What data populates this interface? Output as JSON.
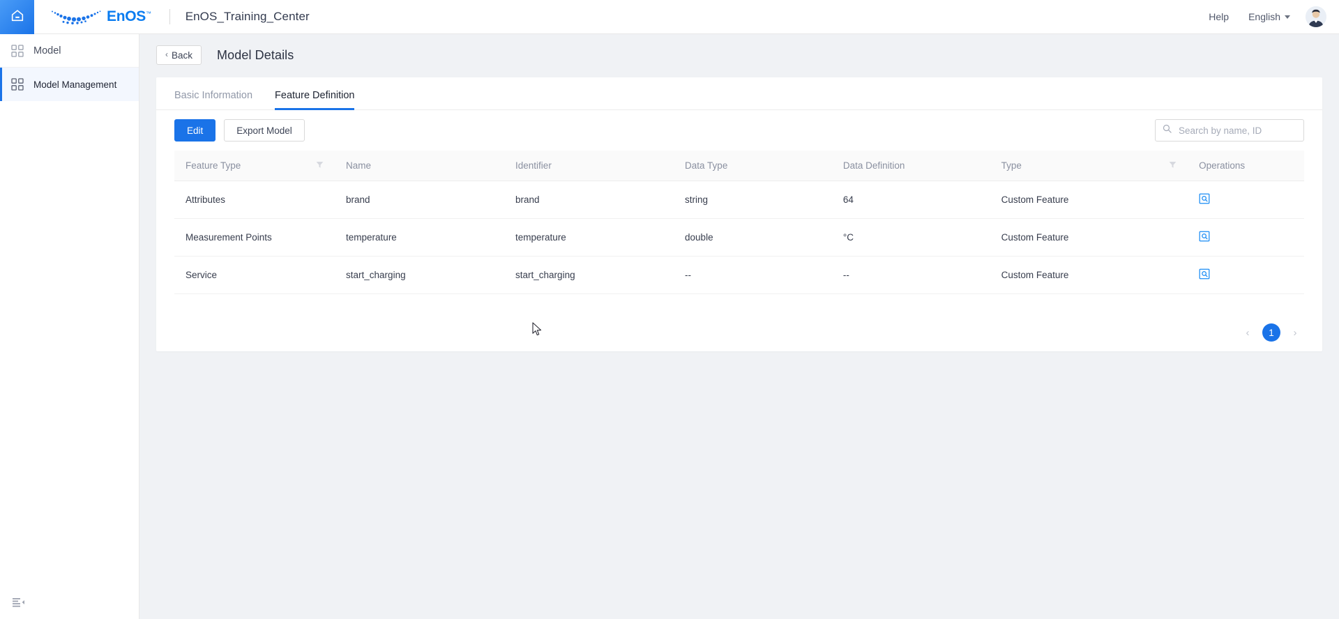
{
  "header": {
    "home_icon": "home-icon",
    "logo_text": "EnOS",
    "logo_tm": "™",
    "project_title": "EnOS_Training_Center",
    "help_label": "Help",
    "language_label": "English",
    "avatar_icon": "user-avatar"
  },
  "sidebar": {
    "items": [
      {
        "label": "Model",
        "icon": "grid-icon",
        "active": false
      },
      {
        "label": "Model Management",
        "icon": "grid-icon",
        "active": true
      }
    ],
    "collapse_icon": "menu-fold-icon"
  },
  "page": {
    "back_label": "Back",
    "back_icon": "chevron-left-icon",
    "title": "Model Details"
  },
  "tabs": [
    {
      "label": "Basic Information",
      "active": false
    },
    {
      "label": "Feature Definition",
      "active": true
    }
  ],
  "toolbar": {
    "edit_label": "Edit",
    "export_label": "Export Model",
    "search_placeholder": "Search by name, ID",
    "search_value": "",
    "search_icon": "search-icon"
  },
  "table": {
    "columns": [
      {
        "label": "Feature Type",
        "filter": true
      },
      {
        "label": "Name",
        "filter": false
      },
      {
        "label": "Identifier",
        "filter": false
      },
      {
        "label": "Data Type",
        "filter": false
      },
      {
        "label": "Data Definition",
        "filter": false
      },
      {
        "label": "Type",
        "filter": true
      },
      {
        "label": "Operations",
        "filter": false
      }
    ],
    "rows": [
      {
        "feature_type": "Attributes",
        "name": "brand",
        "identifier": "brand",
        "data_type": "string",
        "data_definition": "64",
        "type": "Custom Feature",
        "operation_icon": "view-detail-icon"
      },
      {
        "feature_type": "Measurement Points",
        "name": "temperature",
        "identifier": "temperature",
        "data_type": "double",
        "data_definition": "°C",
        "type": "Custom Feature",
        "operation_icon": "view-detail-icon"
      },
      {
        "feature_type": "Service",
        "name": "start_charging",
        "identifier": "start_charging",
        "data_type": "--",
        "data_definition": "--",
        "type": "Custom Feature",
        "operation_icon": "view-detail-icon"
      }
    ]
  },
  "pagination": {
    "prev_icon": "chevron-left-icon",
    "next_icon": "chevron-right-icon",
    "current_page": "1"
  },
  "colors": {
    "accent": "#1a73e8",
    "brand": "#0a7cf0",
    "page_bg": "#f0f2f5",
    "card_bg": "#ffffff",
    "table_header_bg": "#fafafa",
    "sidebar_active_bg": "#f3f7fe"
  }
}
